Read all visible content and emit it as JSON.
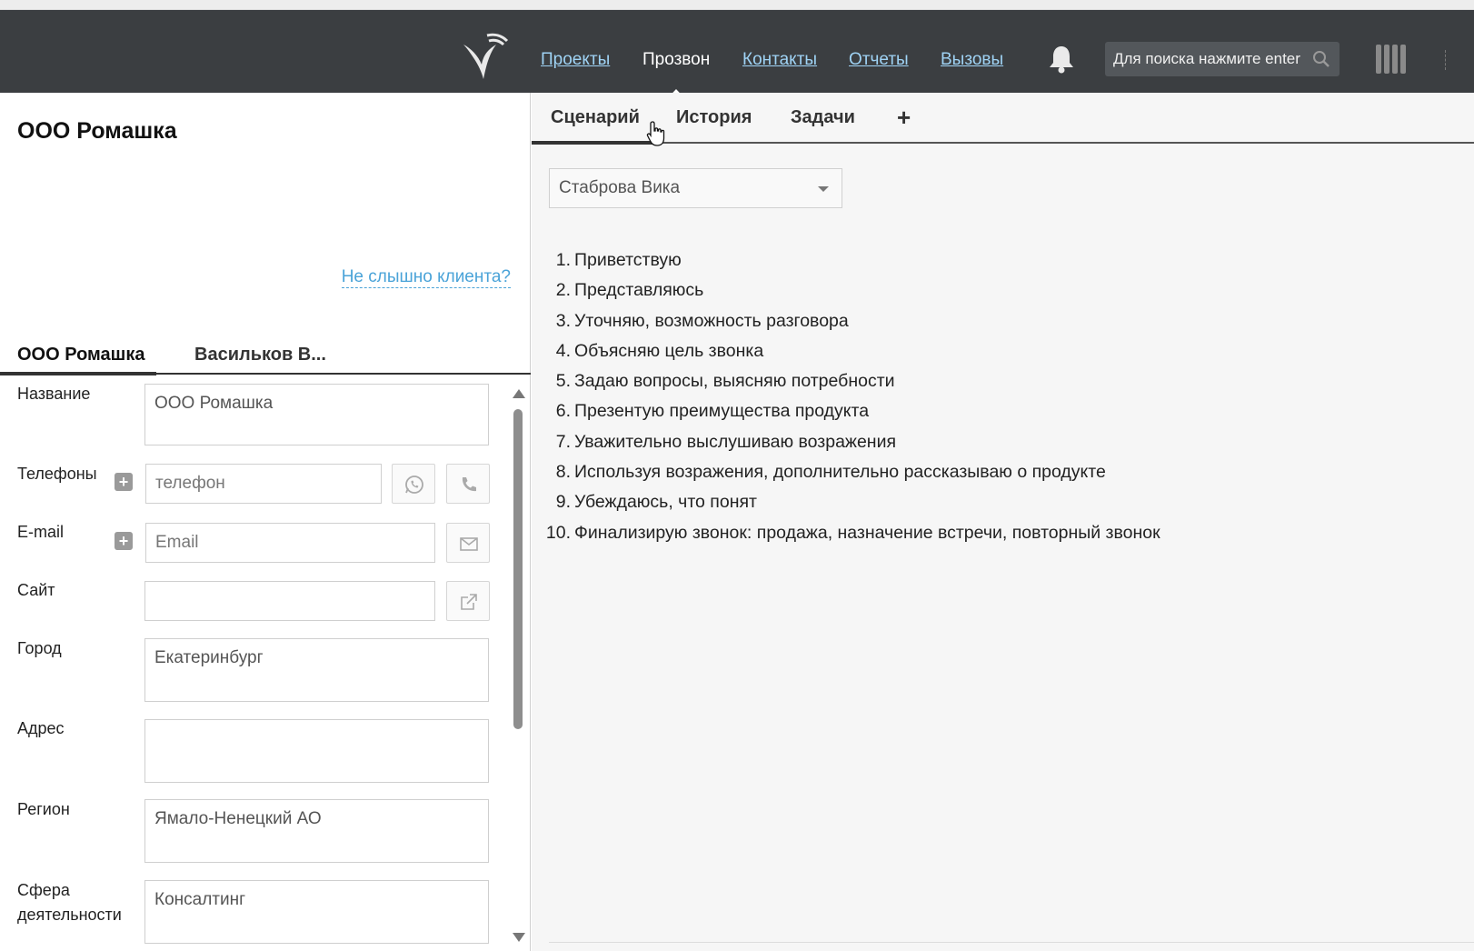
{
  "nav": {
    "links": [
      "Проекты",
      "Прозвон",
      "Контакты",
      "Отчеты",
      "Вызовы"
    ],
    "active": "Прозвон",
    "search_placeholder": "Для поиска нажмите enter"
  },
  "left": {
    "company_title": "ООО Ромашка",
    "cant_hear_link": "Не слышно клиента?",
    "tabs": [
      "ООО Ромашка",
      "Васильков В..."
    ],
    "form": {
      "name_label": "Название",
      "name_value": "ООО Ромашка",
      "phones_label": "Телефоны",
      "phone_placeholder": "телефон",
      "email_label": "E-mail",
      "email_placeholder": "Email",
      "site_label": "Сайт",
      "site_value": "",
      "city_label": "Город",
      "city_value": "Екатеринбург",
      "address_label": "Адрес",
      "address_value": "",
      "region_label": "Регион",
      "region_value": "Ямало-Ненецкий АО",
      "sphere_label_1": "Сфера",
      "sphere_label_2": "деятельности",
      "sphere_value": "Консалтинг"
    }
  },
  "right": {
    "tabs": [
      "Сценарий",
      "История",
      "Задачи"
    ],
    "add_tab": "+",
    "operator_select": "Стаброва Вика",
    "script": [
      {
        "num": "1.",
        "text": "Приветствую"
      },
      {
        "num": "2.",
        "text": "Представляюсь"
      },
      {
        "num": "3.",
        "text": "Уточняю, возможность разговора"
      },
      {
        "num": "4.",
        "text": "Объясняю цель звонка"
      },
      {
        "num": "5.",
        "text": "Задаю вопросы, выясняю потребности"
      },
      {
        "num": "6.",
        "text": "Презентую преимущества продукта"
      },
      {
        "num": "7.",
        "text": "Уважительно выслушиваю возражения"
      },
      {
        "num": "8.",
        "text": "Используя возражения, дополнительно рассказываю о продукте"
      },
      {
        "num": "9.",
        "text": "Убеждаюсь, что понят"
      },
      {
        "num": "10.",
        "text": "Финализирую звонок: продажа, назначение встречи, повторный звонок"
      }
    ]
  },
  "colors": {
    "navbar": "#3b3e41",
    "nav_link": "#9fd3f5",
    "accent_link": "#4aa3d8"
  }
}
